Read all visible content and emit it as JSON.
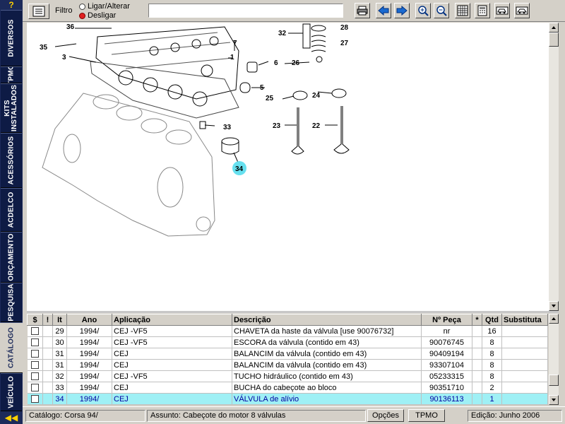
{
  "sidebar": {
    "help": "?",
    "tabs": [
      {
        "id": "diversos",
        "label": "DIVERSOS"
      },
      {
        "id": "tpmo",
        "label": "TPMO"
      },
      {
        "id": "kits",
        "label": "KITS INSTALADOS"
      },
      {
        "id": "acessorios",
        "label": "ACESSÓRIOS"
      },
      {
        "id": "acdelco",
        "label": "ACDELCO"
      },
      {
        "id": "orcamento",
        "label": "ORÇAMENTO"
      },
      {
        "id": "pesquisa",
        "label": "PESQUISA"
      },
      {
        "id": "catalogo",
        "label": "CATÁLOGO"
      },
      {
        "id": "veiculo",
        "label": "VEÍCULO"
      }
    ],
    "bottom": "◀◀"
  },
  "toolbar": {
    "filter_label": "Filtro",
    "radio_on_label": "Ligar/Alterar",
    "radio_off_label": "Desligar",
    "filter_value": ""
  },
  "diagram": {
    "callouts": [
      "36",
      "35",
      "3",
      "7",
      "1",
      "32",
      "28",
      "27",
      "6",
      "26",
      "5",
      "25",
      "24",
      "33",
      "23",
      "22",
      "34"
    ],
    "highlighted": "34"
  },
  "table": {
    "headers": {
      "price": "$",
      "flag": "!",
      "item": "It",
      "year": "Ano",
      "application": "Aplicação",
      "description": "Descrição",
      "part_no": "Nº Peça",
      "star": "*",
      "qty": "Qtd",
      "substitute": "Substituta"
    },
    "rows": [
      {
        "item": "29",
        "year": "1994/",
        "application": "CEJ -VF5",
        "description": "CHAVETA da haste da válvula [use 90076732]",
        "part_no": "nr",
        "qty": "16"
      },
      {
        "item": "30",
        "year": "1994/",
        "application": "CEJ -VF5",
        "description": "ESCORA da válvula (contido em 43)",
        "part_no": "90076745",
        "qty": "8"
      },
      {
        "item": "31",
        "year": "1994/",
        "application": "CEJ",
        "description": "BALANCIM da válvula (contido em 43)",
        "part_no": "90409194",
        "qty": "8"
      },
      {
        "item": "31",
        "year": "1994/",
        "application": "CEJ",
        "description": "BALANCIM da válvula (contido em 43)",
        "part_no": "93307104",
        "qty": "8"
      },
      {
        "item": "32",
        "year": "1994/",
        "application": "CEJ -VF5",
        "description": "TUCHO hidráulico (contido em 43)",
        "part_no": "05233315",
        "qty": "8"
      },
      {
        "item": "33",
        "year": "1994/",
        "application": "CEJ",
        "description": "BUCHA do cabeçote ao bloco",
        "part_no": "90351710",
        "qty": "2"
      },
      {
        "item": "34",
        "year": "1994/",
        "application": "CEJ",
        "description": "VÁLVULA de alívio",
        "part_no": "90136113",
        "qty": "1"
      }
    ],
    "selected_item": "34"
  },
  "status": {
    "catalog": "Catálogo: Corsa 94/",
    "subject": "Assunto: Cabeçote do motor 8 válvulas",
    "options_btn": "Opções",
    "tpmo_btn": "TPMO",
    "edition": "Edição: Junho 2006"
  }
}
